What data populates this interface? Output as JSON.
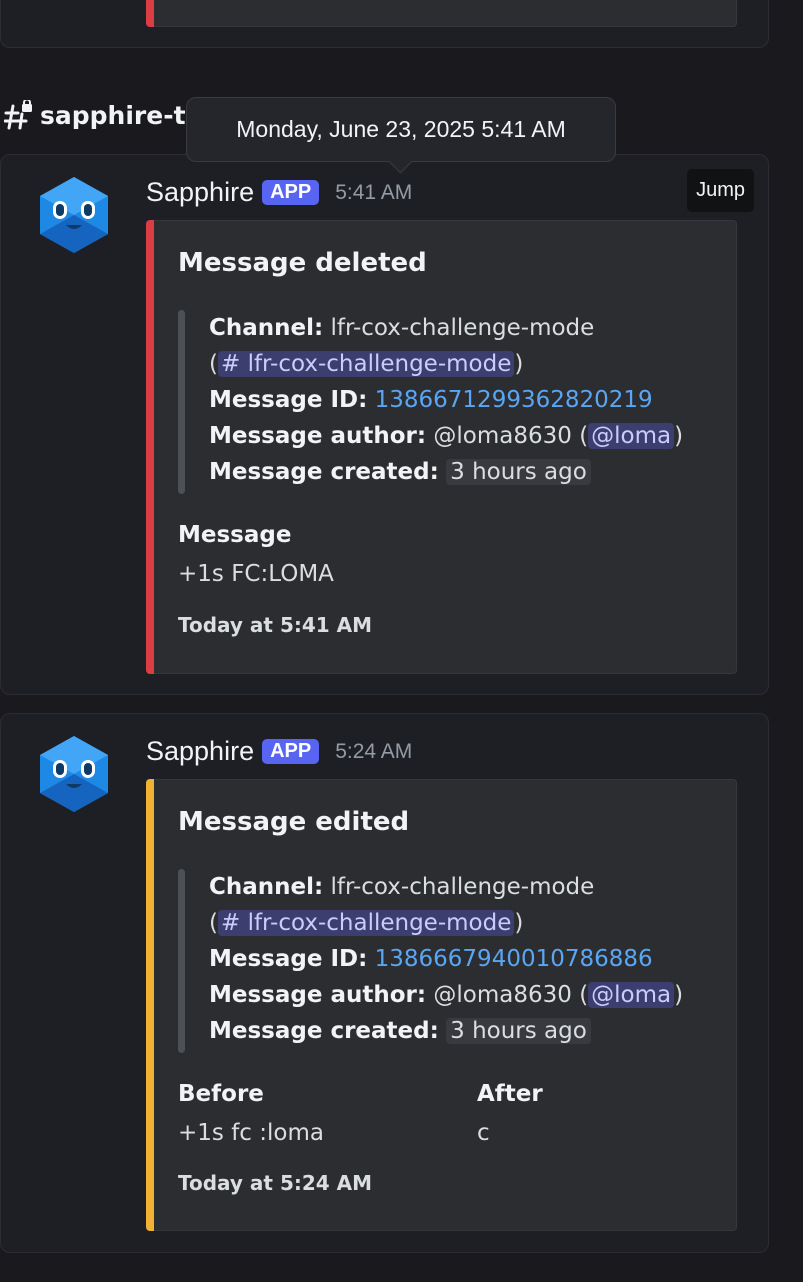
{
  "channel_header": {
    "name": "sapphire-t"
  },
  "tooltip": {
    "text": "Monday, June 23, 2025 5:41 AM"
  },
  "jump_label": "Jump",
  "messages": [
    {
      "author": "Sapphire",
      "badge": "APP",
      "time": "5:41 AM",
      "accent_color": "#da3e44",
      "embed_title": "Message deleted",
      "channel_label": "Channel:",
      "channel_name": "lfr-cox-challenge-mode",
      "channel_open": "(",
      "channel_mention": "# lfr-cox-challenge-mode",
      "channel_close": ")",
      "id_label": "Message ID:",
      "message_id": "1386671299362820219",
      "author_label": "Message author:",
      "author_handle": "@loma8630",
      "author_open": "(",
      "author_mention": "@loma",
      "author_close": ")",
      "created_label": "Message created:",
      "created_value": "3 hours ago",
      "section_title": "Message",
      "section_value": "+1s FC:LOMA",
      "footer": "Today at 5:41 AM"
    },
    {
      "author": "Sapphire",
      "badge": "APP",
      "time": "5:24 AM",
      "accent_color": "#f0b232",
      "embed_title": "Message edited",
      "channel_label": "Channel:",
      "channel_name": "lfr-cox-challenge-mode",
      "channel_open": "(",
      "channel_mention": "# lfr-cox-challenge-mode",
      "channel_close": ")",
      "id_label": "Message ID:",
      "message_id": "1386667940010786886",
      "author_label": "Message author:",
      "author_handle": "@loma8630",
      "author_open": "(",
      "author_mention": "@loma",
      "author_close": ")",
      "created_label": "Message created:",
      "created_value": "3 hours ago",
      "before_title": "Before",
      "before_value": "+1s fc :loma",
      "after_title": "After",
      "after_value": "c",
      "footer": "Today at 5:24 AM"
    }
  ]
}
